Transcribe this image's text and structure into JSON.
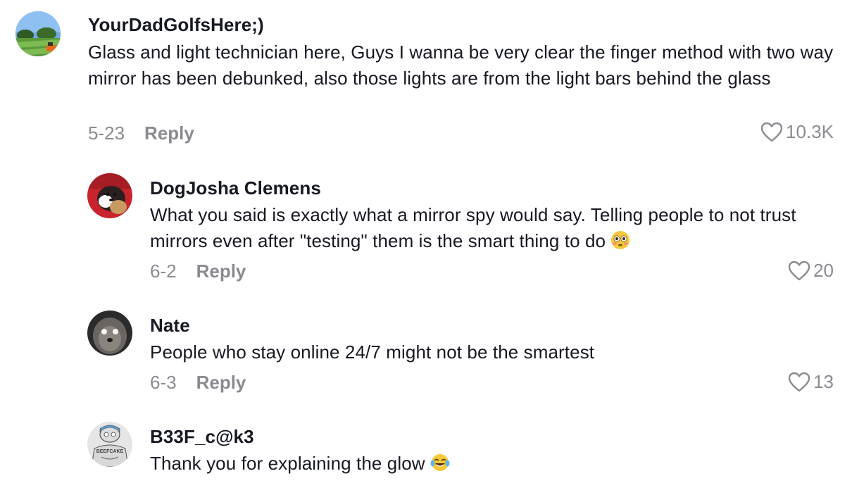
{
  "comments": [
    {
      "username": "YourDadGolfsHere;)",
      "text": "Glass and light technician here, Guys I wanna be very clear the finger method with two way mirror has been debunked, also those lights are from the light bars behind the glass",
      "date": "5-23",
      "reply_label": "Reply",
      "likes": "10.3K",
      "avatar_icon": "golf-course-avatar-icon"
    },
    {
      "username": "DogJosha Clemens",
      "text": "What you said is exactly what a mirror spy would say. Telling people to not trust mirrors even after \"testing\" them is the smart thing to do",
      "emoji": "flushed-face-emoji-icon",
      "date": "6-2",
      "reply_label": "Reply",
      "likes": "20",
      "avatar_icon": "dog-avatar-icon"
    },
    {
      "username": "Nate",
      "text": "People who stay online 24/7 might not be the smartest",
      "date": "6-3",
      "reply_label": "Reply",
      "likes": "13",
      "avatar_icon": "dog-glowing-eyes-avatar-icon"
    },
    {
      "username": "B33F_c@k3",
      "text": "Thank you for explaining the glow",
      "emoji": "tears-of-joy-emoji-icon",
      "avatar_icon": "beefcake-cartoon-avatar-icon",
      "avatar_text": "BEEFCAKE"
    }
  ],
  "colors": {
    "text": "#161823",
    "muted": "#8a8b91",
    "background": "#ffffff"
  }
}
